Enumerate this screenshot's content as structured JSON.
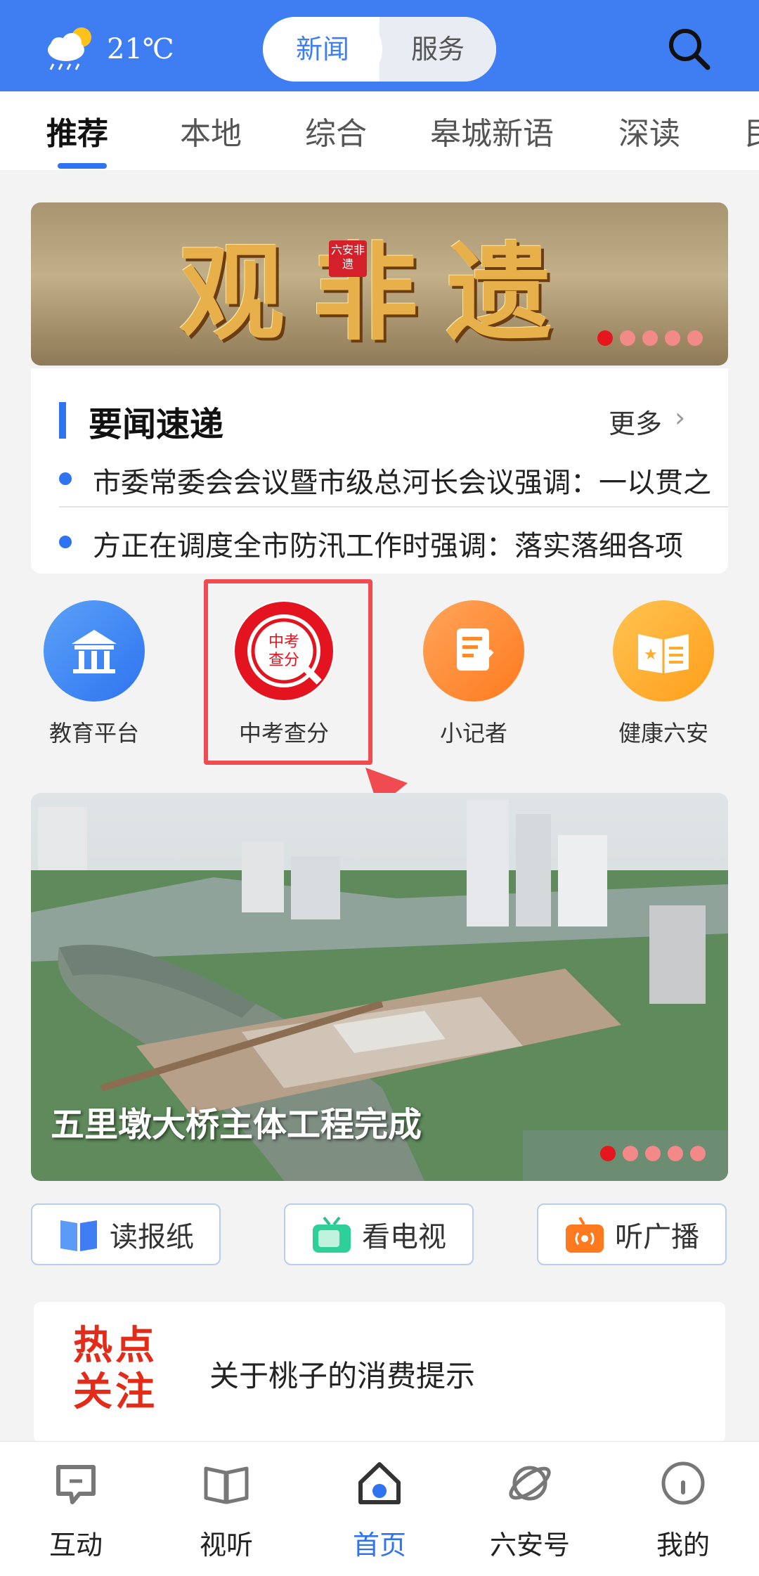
{
  "header": {
    "temperature": "21℃",
    "weather_icon": "cloud-rain-sun-icon",
    "segment": {
      "active": "新闻",
      "inactive": "服务"
    },
    "search_icon": "search-icon",
    "accent": "#3f7ef2"
  },
  "tabs": [
    "推荐",
    "本地",
    "综合",
    "皋城新语",
    "深读",
    "民"
  ],
  "banner": {
    "title": "观非遗",
    "seal": "六安非遗"
  },
  "news": {
    "heading": "要闻速递",
    "more": "更多",
    "items": [
      "市委常委会会议暨市级总河长会议强调：一以贯之",
      "方正在调度全市防汛工作时强调：落实落细各项"
    ]
  },
  "quick": [
    {
      "label": "教育平台",
      "icon": "education-building-icon",
      "color": "#3f8cf3"
    },
    {
      "label": "中考查分",
      "icon": "exam-score-icon",
      "color": "#e3141f",
      "badge": "中考查分"
    },
    {
      "label": "小记者",
      "icon": "reporter-note-icon",
      "color": "#ff8a2b"
    },
    {
      "label": "健康六安",
      "icon": "health-book-icon",
      "color": "#ffab2e"
    }
  ],
  "photo": {
    "caption": "五里墩大桥主体工程完成"
  },
  "media": [
    {
      "label": "读报纸",
      "icon": "newspaper-icon"
    },
    {
      "label": "看电视",
      "icon": "tv-icon"
    },
    {
      "label": "听广播",
      "icon": "radio-icon"
    }
  ],
  "hot": {
    "logo": "热点关注",
    "text": "关于桃子的消费提示"
  },
  "bottom_nav": [
    {
      "label": "互动",
      "icon": "chat-icon"
    },
    {
      "label": "视听",
      "icon": "book-icon"
    },
    {
      "label": "首页",
      "icon": "home-icon"
    },
    {
      "label": "六安号",
      "icon": "planet-icon"
    },
    {
      "label": "我的",
      "icon": "profile-icon"
    }
  ]
}
